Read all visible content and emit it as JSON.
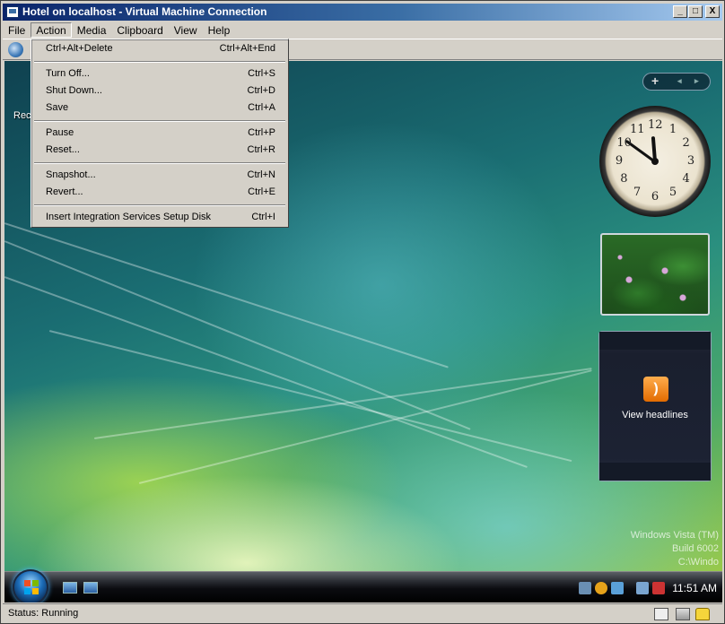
{
  "window": {
    "title": "Hotel on localhost - Virtual Machine Connection",
    "minimize": "_",
    "maximize": "□",
    "close": "X"
  },
  "menubar": {
    "items": [
      "File",
      "Action",
      "Media",
      "Clipboard",
      "View",
      "Help"
    ]
  },
  "action_menu": {
    "items": [
      {
        "label": "Ctrl+Alt+Delete",
        "shortcut": "Ctrl+Alt+End"
      },
      {
        "label": "Turn Off...",
        "shortcut": "Ctrl+S"
      },
      {
        "label": "Shut Down...",
        "shortcut": "Ctrl+D"
      },
      {
        "label": "Save",
        "shortcut": "Ctrl+A"
      },
      {
        "label": "Pause",
        "shortcut": "Ctrl+P"
      },
      {
        "label": "Reset...",
        "shortcut": "Ctrl+R"
      },
      {
        "label": "Snapshot...",
        "shortcut": "Ctrl+N"
      },
      {
        "label": "Revert...",
        "shortcut": "Ctrl+E"
      },
      {
        "label": "Insert Integration Services Setup Disk",
        "shortcut": "Ctrl+I"
      }
    ]
  },
  "desktop": {
    "recycle_label": "Rec",
    "cursor": "ʶ",
    "gadget_nav_add": "+",
    "gadget_nav_arrows": "◂ ▸",
    "clock": {
      "numbers": [
        "12",
        "1",
        "2",
        "3",
        "4",
        "5",
        "6",
        "7",
        "8",
        "9",
        "10",
        "11"
      ],
      "time": "11:51"
    },
    "feed": {
      "icon": "rss-icon",
      "text": "View headlines"
    },
    "watermark": {
      "line1": "Windows Vista (TM)",
      "line2": "Build 6002",
      "line3": "C:\\Windo"
    }
  },
  "taskbar": {
    "time": "11:51 AM"
  },
  "statusbar": {
    "text": "Status: Running"
  }
}
